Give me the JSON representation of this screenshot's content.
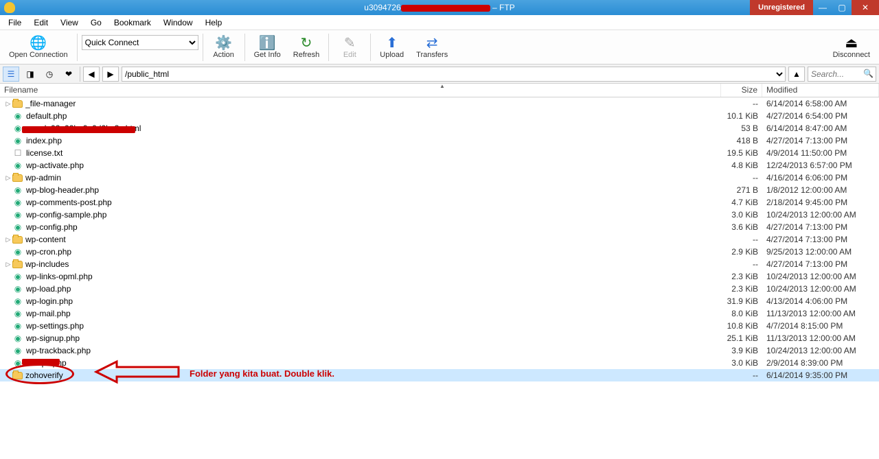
{
  "title": {
    "prefix": "u3094726",
    "suffix": " – FTP",
    "unregistered": "Unregistered"
  },
  "menu": [
    "File",
    "Edit",
    "View",
    "Go",
    "Bookmark",
    "Window",
    "Help"
  ],
  "toolbar": {
    "open": "Open Connection",
    "quick": "Quick Connect",
    "action": "Action",
    "getinfo": "Get Info",
    "refresh": "Refresh",
    "edit": "Edit",
    "upload": "Upload",
    "transfers": "Transfers",
    "disconnect": "Disconnect"
  },
  "nav": {
    "path": "/public_html",
    "search_placeholder": "Search..."
  },
  "cols": {
    "name": "Filename",
    "size": "Size",
    "mod": "Modified"
  },
  "files": [
    {
      "t": "folder",
      "exp": true,
      "n": "_file-manager",
      "s": "--",
      "m": "6/14/2014 6:58:00 AM"
    },
    {
      "t": "php",
      "n": "default.php",
      "s": "10.1 KiB",
      "m": "4/27/2014 6:54:00 PM"
    },
    {
      "t": "html",
      "n": "google02a00ba0a0d0bc3c.html",
      "s": "53 B",
      "m": "6/14/2014 8:47:00 AM",
      "strike": true
    },
    {
      "t": "php",
      "n": "index.php",
      "s": "418 B",
      "m": "4/27/2014 7:13:00 PM"
    },
    {
      "t": "txt",
      "n": "license.txt",
      "s": "19.5 KiB",
      "m": "4/9/2014 11:50:00 PM"
    },
    {
      "t": "php",
      "n": "wp-activate.php",
      "s": "4.8 KiB",
      "m": "12/24/2013 6:57:00 PM"
    },
    {
      "t": "folder",
      "exp": true,
      "n": "wp-admin",
      "s": "--",
      "m": "4/16/2014 6:06:00 PM"
    },
    {
      "t": "php",
      "n": "wp-blog-header.php",
      "s": "271 B",
      "m": "1/8/2012 12:00:00 AM"
    },
    {
      "t": "php",
      "n": "wp-comments-post.php",
      "s": "4.7 KiB",
      "m": "2/18/2014 9:45:00 PM"
    },
    {
      "t": "php",
      "n": "wp-config-sample.php",
      "s": "3.0 KiB",
      "m": "10/24/2013 12:00:00 AM"
    },
    {
      "t": "php",
      "n": "wp-config.php",
      "s": "3.6 KiB",
      "m": "4/27/2014 7:13:00 PM"
    },
    {
      "t": "folder",
      "exp": true,
      "n": "wp-content",
      "s": "--",
      "m": "4/27/2014 7:13:00 PM"
    },
    {
      "t": "php",
      "n": "wp-cron.php",
      "s": "2.9 KiB",
      "m": "9/25/2013 12:00:00 AM"
    },
    {
      "t": "folder",
      "exp": true,
      "n": "wp-includes",
      "s": "--",
      "m": "4/27/2014 7:13:00 PM"
    },
    {
      "t": "php",
      "n": "wp-links-opml.php",
      "s": "2.3 KiB",
      "m": "10/24/2013 12:00:00 AM"
    },
    {
      "t": "php",
      "n": "wp-load.php",
      "s": "2.3 KiB",
      "m": "10/24/2013 12:00:00 AM"
    },
    {
      "t": "php",
      "n": "wp-login.php",
      "s": "31.9 KiB",
      "m": "4/13/2014 4:06:00 PM"
    },
    {
      "t": "php",
      "n": "wp-mail.php",
      "s": "8.0 KiB",
      "m": "11/13/2013 12:00:00 AM"
    },
    {
      "t": "php",
      "n": "wp-settings.php",
      "s": "10.8 KiB",
      "m": "4/7/2014 8:15:00 PM"
    },
    {
      "t": "php",
      "n": "wp-signup.php",
      "s": "25.1 KiB",
      "m": "11/13/2013 12:00:00 AM"
    },
    {
      "t": "php",
      "n": "wp-trackback.php",
      "s": "3.9 KiB",
      "m": "10/24/2013 12:00:00 AM"
    },
    {
      "t": "php",
      "n": "xmlrpc.php",
      "s": "3.0 KiB",
      "m": "2/9/2014 8:39:00 PM",
      "strike": true
    },
    {
      "t": "folder",
      "n": "zohoverify",
      "s": "--",
      "m": "6/14/2014 9:35:00 PM",
      "sel": true
    }
  ],
  "annotation": "Folder yang kita buat. Double klik."
}
